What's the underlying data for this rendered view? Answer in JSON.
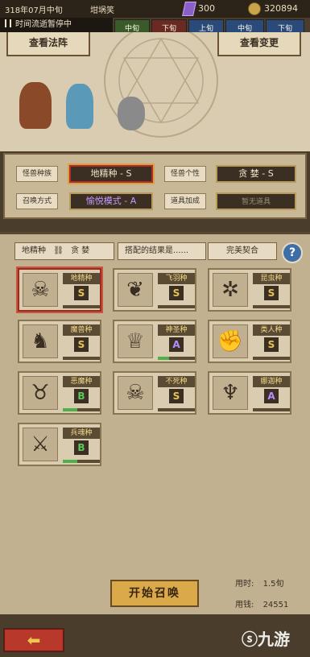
{
  "topbar": {
    "date": "318年07月中旬",
    "status": "坩埚笑",
    "gems": "300",
    "coins": "320894"
  },
  "pause": {
    "label": "时间流逝暂停中"
  },
  "timeline": {
    "segments": [
      "中旬",
      "下旬",
      "上旬",
      "中旬",
      "下旬"
    ]
  },
  "scene": {
    "left_button": "查看法阵",
    "right_button": "查看变更"
  },
  "config": {
    "species_label": "怪兽种族",
    "species_value": "地精种 - S",
    "trait_label": "怪兽个性",
    "trait_value": "贪 婪 - S",
    "summon_label": "召唤方式",
    "summon_value": "愉悦模式 - A",
    "item_label": "道具加成",
    "item_value": "暂无道具"
  },
  "results": {
    "head_species": "地精种",
    "head_trait": "贪 婪",
    "head_result": "搭配的结果是......",
    "head_verdict": "完美契合",
    "help": "?",
    "cards": [
      {
        "name": "地精种",
        "grade": "S",
        "color": "#e6c35a",
        "icon": "☠",
        "progress": 0
      },
      {
        "name": "飞羽种",
        "grade": "S",
        "color": "#e6c35a",
        "icon": "❦",
        "progress": 0
      },
      {
        "name": "昆虫种",
        "grade": "S",
        "color": "#e6c35a",
        "icon": "✲",
        "progress": 0
      },
      {
        "name": "魔兽种",
        "grade": "S",
        "color": "#e6c35a",
        "icon": "♞",
        "progress": 0
      },
      {
        "name": "神圣种",
        "grade": "A",
        "color": "#b48cff",
        "icon": "♕",
        "progress": 0.3
      },
      {
        "name": "类人种",
        "grade": "S",
        "color": "#e6c35a",
        "icon": "✊",
        "progress": 0
      },
      {
        "name": "恶魔种",
        "grade": "B",
        "color": "#5cc75a",
        "icon": "♉",
        "progress": 0.4
      },
      {
        "name": "不死种",
        "grade": "S",
        "color": "#e6c35a",
        "icon": "☠",
        "progress": 0
      },
      {
        "name": "娜迦种",
        "grade": "A",
        "color": "#b48cff",
        "icon": "♆",
        "progress": 0
      },
      {
        "name": "兵魂种",
        "grade": "B",
        "color": "#5cc75a",
        "icon": "⚔",
        "progress": 0.4
      }
    ]
  },
  "footer": {
    "start": "开始召唤",
    "time_label": "用时:",
    "time_value": "1.5旬",
    "cost_label": "用钱:",
    "cost_value": "24551",
    "back": "⬅",
    "watermark": "九游"
  }
}
